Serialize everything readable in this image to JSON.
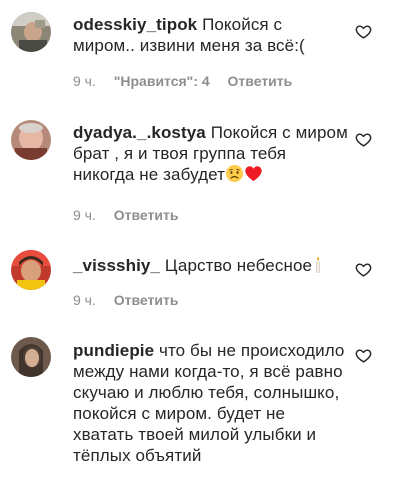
{
  "comments": [
    {
      "username": "odesskiy_tipok",
      "text": "Покойся с миром.. извини меня за всё:(",
      "time": "9 ч.",
      "likes": "\"Нравится\": 4",
      "reply": "Ответить"
    },
    {
      "username": "dyadya._.kostya",
      "text": "Покойся с миром брат , я и твоя группа тебя никогда не забудет",
      "time": "9 ч.",
      "reply": "Ответить"
    },
    {
      "username": "_vissshiy_",
      "text": "Царство небесное",
      "time": "9 ч.",
      "reply": "Ответить"
    },
    {
      "username": "pundiepie",
      "text": "что бы не происходило между нами когда-то, я всё равно скучаю и люблю тебя, солнышко, покойся с миром. будет не хватать твоей милой улыбки и тёплых объятий"
    }
  ],
  "colors": {
    "text": "#262626",
    "secondary": "#8e8e8e",
    "heart_outline": "#262626",
    "emoji_heart": "#ed1c24"
  },
  "icons": {
    "like": "heart-outline-icon",
    "sad_face": "disappointed-face-emoji",
    "red_heart": "red-heart-emoji",
    "candle": "candle-emoji"
  }
}
